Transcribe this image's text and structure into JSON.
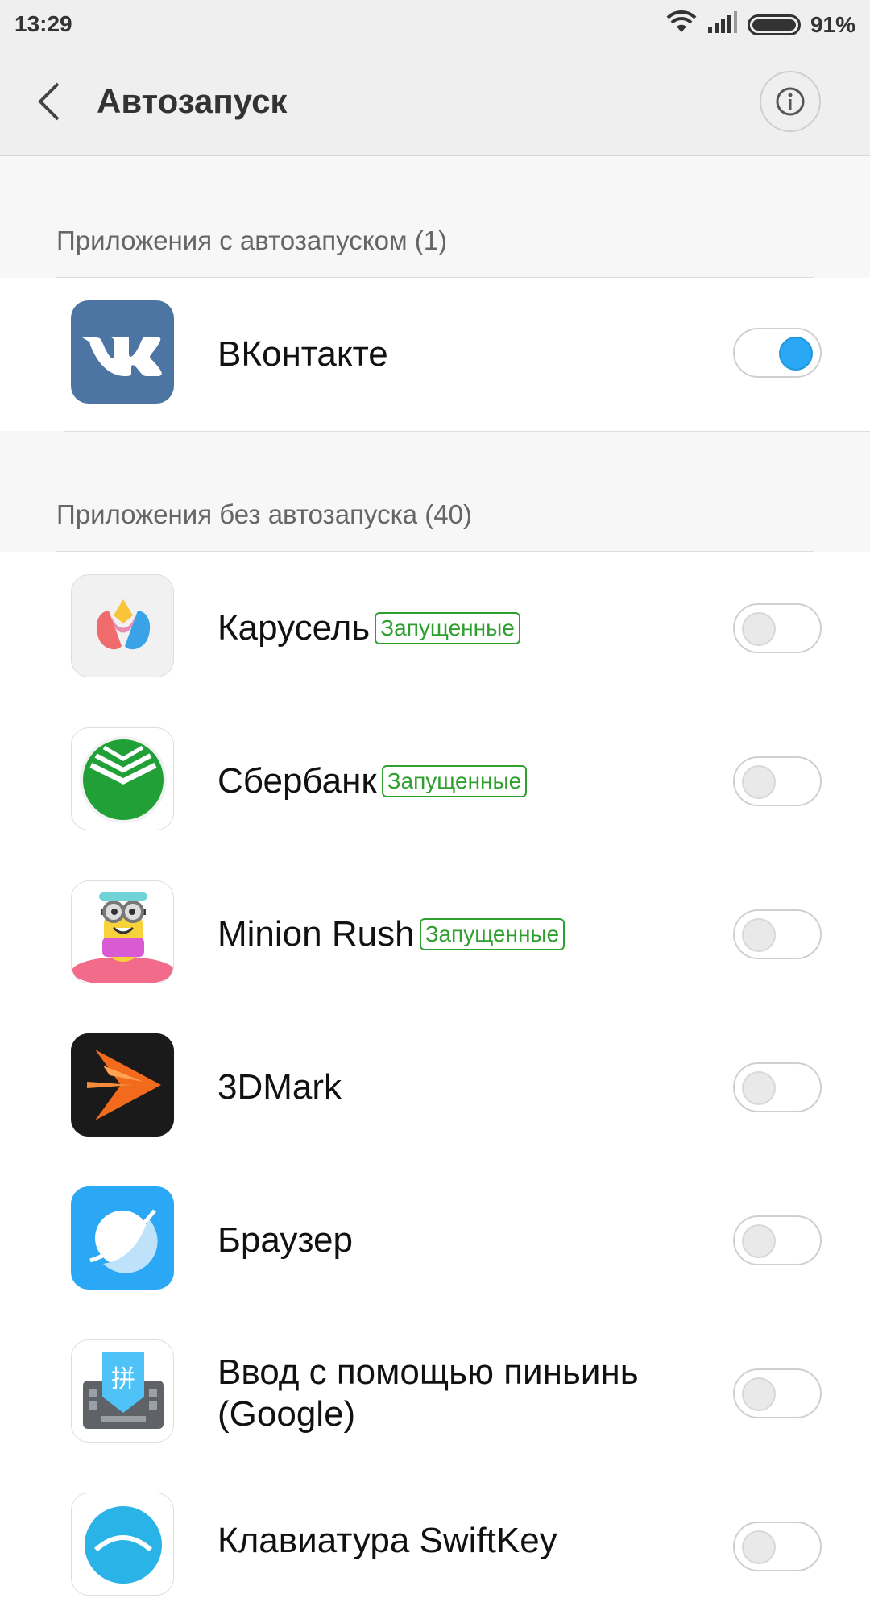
{
  "status_bar": {
    "time": "13:29",
    "battery": "91%"
  },
  "app_bar": {
    "title": "Автозапуск",
    "back_icon": "chevron-left-icon",
    "info_icon": "info-icon"
  },
  "sections": [
    {
      "header": "Приложения с автозапуском (1)",
      "apps": [
        {
          "name": "ВКонтакте",
          "badge": "",
          "enabled": true,
          "icon": "vk-icon"
        }
      ]
    },
    {
      "header": "Приложения без автозапуска (40)",
      "apps": [
        {
          "name": "Карусель",
          "badge": "Запущенные",
          "enabled": false,
          "icon": "tulip-icon"
        },
        {
          "name": "Сбербанк",
          "badge": "Запущенные",
          "enabled": false,
          "icon": "sberbank-icon"
        },
        {
          "name": "Minion Rush",
          "badge": "Запущенные",
          "enabled": false,
          "icon": "minion-icon"
        },
        {
          "name": "3DMark",
          "badge": "",
          "enabled": false,
          "icon": "3dmark-icon"
        },
        {
          "name": "Браузер",
          "badge": "",
          "enabled": false,
          "icon": "browser-icon"
        },
        {
          "name": "Ввод с помощью пиньинь (Google)",
          "badge": "",
          "enabled": false,
          "icon": "pinyin-keyboard-icon"
        },
        {
          "name": "Клавиатура SwiftKey",
          "badge": "",
          "enabled": false,
          "icon": "swiftkey-icon"
        }
      ]
    }
  ],
  "colors": {
    "accent": "#2aa7f5",
    "badge": "#2fa02f",
    "background": "#f7f7f7"
  }
}
